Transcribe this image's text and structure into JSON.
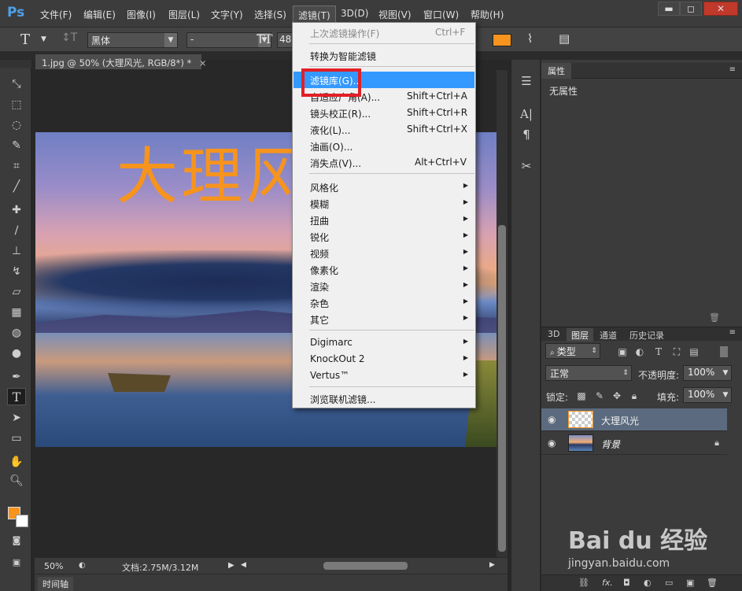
{
  "app": {
    "logo": "Ps",
    "menu": [
      "文件(F)",
      "编辑(E)",
      "图像(I)",
      "图层(L)",
      "文字(Y)",
      "选择(S)",
      "滤镜(T)",
      "3D(D)",
      "视图(V)",
      "窗口(W)",
      "帮助(H)"
    ],
    "window_controls": {
      "minimize": "▬",
      "maximize": "◻",
      "close": "✕"
    }
  },
  "options": {
    "font_family": "黑体",
    "font_style": "-",
    "font_size": "48",
    "text_color": "#f7941d"
  },
  "document": {
    "tab_title": "1.jpg @ 50% (大理风光, RGB/8*) *",
    "canvas_text": "大理风光",
    "zoom": "50%",
    "doc_size": "文档:2.75M/3.12M"
  },
  "timeline": {
    "label": "时间轴"
  },
  "properties": {
    "tab": "属性",
    "empty_text": "无属性"
  },
  "layers": {
    "tabs": [
      "3D",
      "图层",
      "通道",
      "历史记录"
    ],
    "filter_kind": "类型",
    "blend_mode": "正常",
    "opacity_label": "不透明度:",
    "opacity_value": "100%",
    "lock_label": "锁定:",
    "fill_label": "填充:",
    "fill_value": "100%",
    "items": [
      {
        "name": "大理风光",
        "selected": true
      },
      {
        "name": "背景",
        "locked": true
      }
    ]
  },
  "filter_menu": {
    "last_filter": {
      "label": "上次滤镜操作(F)",
      "shortcut": "Ctrl+F"
    },
    "smart": "转换为智能滤镜",
    "gallery": "滤镜库(G)...",
    "items_a": [
      {
        "label": "自适应广角(A)...",
        "shortcut": "Shift+Ctrl+A"
      },
      {
        "label": "镜头校正(R)...",
        "shortcut": "Shift+Ctrl+R"
      },
      {
        "label": "液化(L)...",
        "shortcut": "Shift+Ctrl+X"
      },
      {
        "label": "油画(O)...",
        "shortcut": ""
      },
      {
        "label": "消失点(V)...",
        "shortcut": "Alt+Ctrl+V"
      }
    ],
    "submenus": [
      "风格化",
      "模糊",
      "扭曲",
      "锐化",
      "视频",
      "像素化",
      "渲染",
      "杂色",
      "其它"
    ],
    "plugins": [
      "Digimarc",
      "KnockOut 2",
      "Vertus™"
    ],
    "browse": "浏览联机滤镜..."
  },
  "watermark": {
    "logo": "Bai du 经验",
    "url": "jingyan.baidu.com"
  },
  "colors": {
    "accent_orange": "#f7941d",
    "menu_highlight": "#3399ff",
    "annotation_red": "#e21f26"
  }
}
